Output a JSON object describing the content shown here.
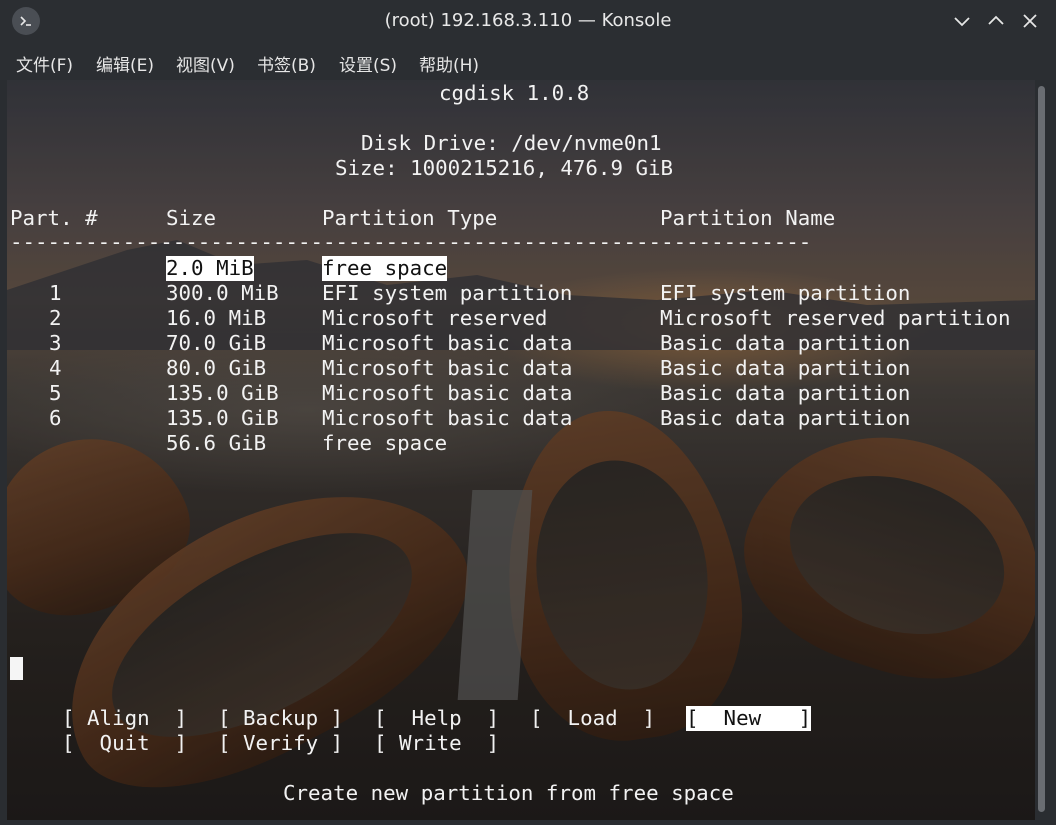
{
  "window": {
    "title": "(root) 192.168.3.110 — Konsole"
  },
  "menu": [
    "文件(F)",
    "编辑(E)",
    "视图(V)",
    "书签(B)",
    "设置(S)",
    "帮助(H)"
  ],
  "cgdisk": {
    "app_title": "cgdisk 1.0.8",
    "disk_drive": "Disk Drive: /dev/nvme0n1",
    "size": "Size: 1000215216, 476.9 GiB",
    "columns": {
      "part": "Part. #",
      "size": "Size",
      "type": "Partition Type",
      "name": "Partition Name"
    },
    "separator": "----------------------------------------------------------------",
    "rows": [
      {
        "num": "",
        "size": "2.0 MiB",
        "type": "free space",
        "name": "",
        "selected": true
      },
      {
        "num": "1",
        "size": "300.0 MiB",
        "type": "EFI system partition",
        "name": "EFI system partition"
      },
      {
        "num": "2",
        "size": "16.0 MiB",
        "type": "Microsoft reserved",
        "name": "Microsoft reserved partition"
      },
      {
        "num": "3",
        "size": "70.0 GiB",
        "type": "Microsoft basic data",
        "name": "Basic data partition"
      },
      {
        "num": "4",
        "size": "80.0 GiB",
        "type": "Microsoft basic data",
        "name": "Basic data partition"
      },
      {
        "num": "5",
        "size": "135.0 GiB",
        "type": "Microsoft basic data",
        "name": "Basic data partition"
      },
      {
        "num": "6",
        "size": "135.0 GiB",
        "type": "Microsoft basic data",
        "name": "Basic data partition"
      },
      {
        "num": "",
        "size": "56.6 GiB",
        "type": "free space",
        "name": ""
      }
    ],
    "actions": {
      "align": "[ Align  ]",
      "backup": "[ Backup ]",
      "help": "[  Help  ]",
      "load": "[  Load  ]",
      "new": "[  New   ]",
      "quit": "[  Quit  ]",
      "verify": "[ Verify ]",
      "write": "[ Write  ]"
    },
    "status": "Create new partition from free space"
  }
}
